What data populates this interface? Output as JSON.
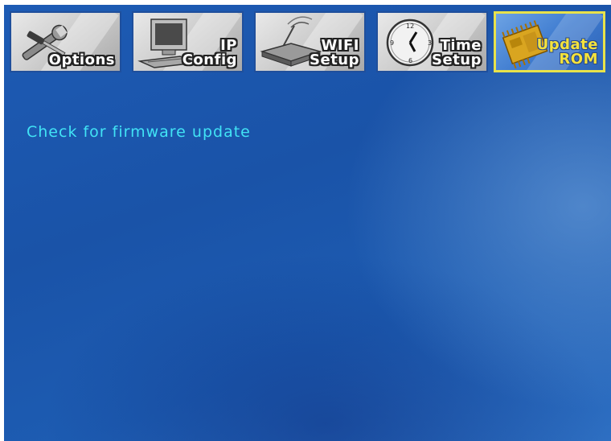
{
  "colors": {
    "background": "#1d5bb4",
    "heading_text": "#41e3f5",
    "active_tab_border": "#e8e24a",
    "active_tab_text": "#f4e23c",
    "tab_text": "#ffffff"
  },
  "tabs": [
    {
      "id": "options",
      "line1": "",
      "line2": "Options",
      "icon": "wrench-screwdriver-icon",
      "active": false
    },
    {
      "id": "ip-config",
      "line1": "IP",
      "line2": "Config",
      "icon": "computer-icon",
      "active": false
    },
    {
      "id": "wifi-setup",
      "line1": "WIFI",
      "line2": "Setup",
      "icon": "router-icon",
      "active": false
    },
    {
      "id": "time-setup",
      "line1": "Time",
      "line2": "Setup",
      "icon": "clock-icon",
      "active": false
    },
    {
      "id": "update-rom",
      "line1": "Update",
      "line2": "ROM",
      "icon": "chip-icon",
      "active": true
    }
  ],
  "main": {
    "heading": "Check for firmware update"
  }
}
